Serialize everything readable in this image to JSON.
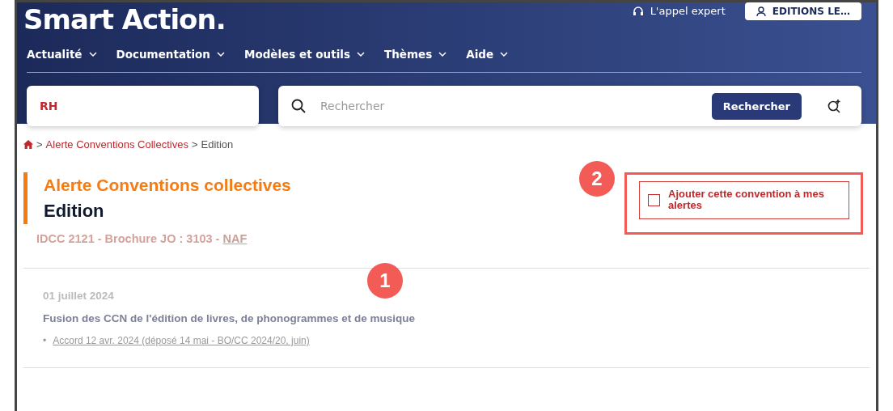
{
  "header": {
    "logo": "Smart Action.",
    "expert_link": "L'appel expert",
    "account_button": "EDITIONS LE…",
    "menu": [
      {
        "label": "Actualité"
      },
      {
        "label": "Documentation"
      },
      {
        "label": "Modèles et outils"
      },
      {
        "label": "Thèmes"
      },
      {
        "label": "Aide"
      }
    ]
  },
  "domain_field": {
    "value": "RH"
  },
  "search": {
    "placeholder": "Rechercher",
    "button": "Rechercher"
  },
  "breadcrumb": [
    {
      "separator": ">",
      "label": "Alerte Conventions Collectives",
      "link": true
    },
    {
      "separator": ">",
      "label": "Edition",
      "link": false
    }
  ],
  "page": {
    "title": "Alerte Conventions collectives",
    "subtitle": "Edition",
    "meta": "IDCC 2121 - Brochure JO : 3103 - ",
    "meta_link": "NAF"
  },
  "alert_checkbox": {
    "label": "Ajouter cette convention à mes alertes",
    "checked": false
  },
  "callouts": [
    {
      "number": "1"
    },
    {
      "number": "2"
    }
  ],
  "entries": [
    {
      "date": "01 juillet 2024",
      "title": "Fusion des CCN de l'édition de livres, de phonogrammes et de musique",
      "links": [
        {
          "bullet": "•",
          "label": "Accord 12 avr. 2024 (déposé 14 mai - BO/CC 2024/20, juin)"
        }
      ]
    }
  ]
}
